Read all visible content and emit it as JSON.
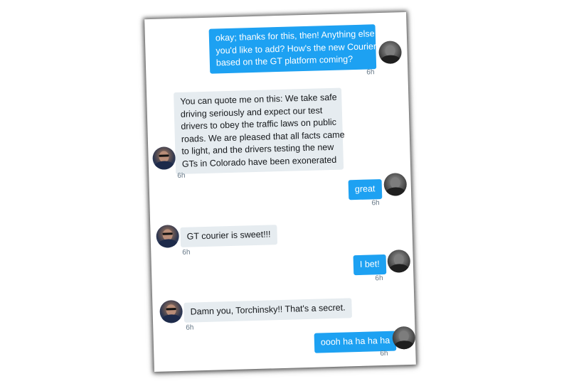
{
  "conversation": {
    "messages": [
      {
        "direction": "outgoing",
        "lines": [
          "okay; thanks for this, then! Anything else",
          "you'd like to add? How's the new Courier",
          "based on the GT platform coming?"
        ],
        "time": "6h"
      },
      {
        "direction": "incoming",
        "lines": [
          "You can quote me on this: We take safe",
          "driving seriously and expect our test",
          "drivers to obey the traffic laws on public",
          "roads. We are pleased that all facts came",
          "to light, and the drivers testing the new",
          "GTs in Colorado have been exonerated"
        ],
        "time": "6h"
      },
      {
        "direction": "outgoing",
        "lines": [
          "great"
        ],
        "time": "6h"
      },
      {
        "direction": "incoming",
        "lines": [
          "GT courier is sweet!!!"
        ],
        "time": "6h"
      },
      {
        "direction": "outgoing",
        "lines": [
          "I bet!"
        ],
        "time": "6h"
      },
      {
        "direction": "incoming",
        "lines": [
          "Damn you, Torchinsky!! That's a secret."
        ],
        "time": "6h"
      },
      {
        "direction": "outgoing",
        "lines": [
          "oooh ha ha ha ha"
        ],
        "time": "6h"
      }
    ]
  },
  "icons": {
    "outgoing_avatar": "user-avatar-photo",
    "incoming_avatar": "contact-avatar-photo-sunglasses"
  },
  "colors": {
    "outgoing_bubble": "#1da1f2",
    "incoming_bubble": "#e6ecf0",
    "timestamp": "#657786"
  }
}
